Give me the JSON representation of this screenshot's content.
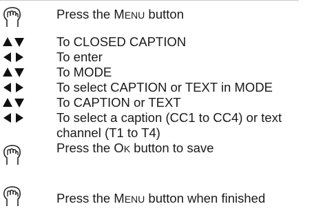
{
  "steps": [
    {
      "icon": "hand-press-icon",
      "pre": "Press the ",
      "cap1": "M",
      "sc1": "ENU",
      "post": " button"
    },
    {
      "icon": "up-down-arrows-icon",
      "text": "To CLOSED CAPTION"
    },
    {
      "icon": "left-right-arrows-icon",
      "text": "To enter"
    },
    {
      "icon": "up-down-arrows-icon",
      "text": "To MODE"
    },
    {
      "icon": "left-right-arrows-icon",
      "text": "To select CAPTION or TEXT in MODE"
    },
    {
      "icon": "up-down-arrows-icon",
      "text": "To CAPTION or TEXT"
    },
    {
      "icon": "left-right-arrows-icon",
      "text": "To select a caption (CC1 to CC4) or text channel (T1 to T4)"
    },
    {
      "icon": "hand-press-icon",
      "pre": "Press the ",
      "cap1": "O",
      "sc1": "K",
      "post": " button to save"
    },
    {
      "icon": "hand-press-icon",
      "pre": "Press the ",
      "cap1": "M",
      "sc1": "ENU",
      "post": " button when finished"
    }
  ]
}
